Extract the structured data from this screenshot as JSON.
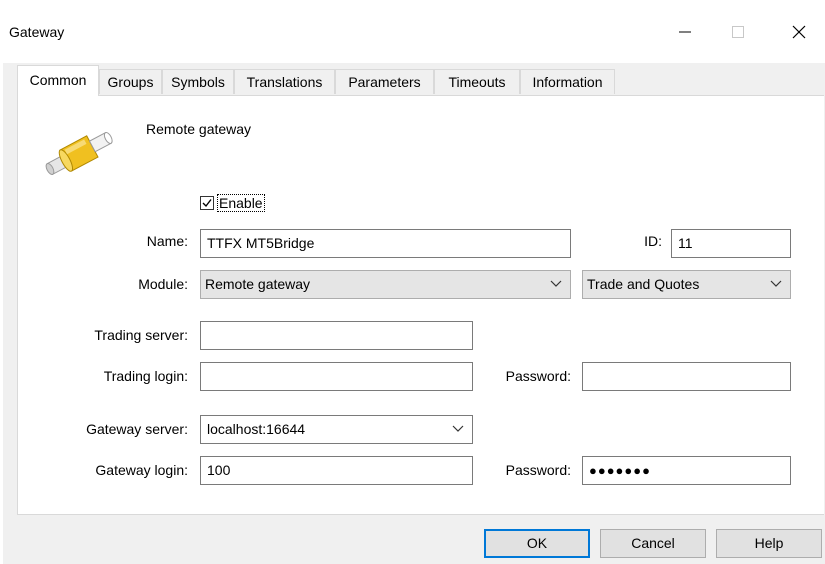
{
  "window": {
    "title": "Gateway"
  },
  "tabs": [
    {
      "label": "Common",
      "active": true
    },
    {
      "label": "Groups"
    },
    {
      "label": "Symbols"
    },
    {
      "label": "Translations"
    },
    {
      "label": "Parameters"
    },
    {
      "label": "Timeouts"
    },
    {
      "label": "Information"
    }
  ],
  "header": {
    "label": "Remote gateway",
    "icon": "gateway-connector-icon"
  },
  "enable": {
    "label": "Enable",
    "checked": true
  },
  "form": {
    "name_label": "Name:",
    "name_value": "TTFX MT5Bridge",
    "id_label": "ID:",
    "id_value": "11",
    "module_label": "Module:",
    "module_value": "Remote gateway",
    "mode_value": "Trade and Quotes",
    "trading_server_label": "Trading server:",
    "trading_server_value": "",
    "trading_login_label": "Trading login:",
    "trading_login_value": "",
    "trading_password_label": "Password:",
    "trading_password_value": "",
    "gateway_server_label": "Gateway server:",
    "gateway_server_value": "localhost:16644",
    "gateway_login_label": "Gateway login:",
    "gateway_login_value": "100",
    "gateway_password_label": "Password:",
    "gateway_password_value": "●●●●●●●"
  },
  "buttons": {
    "ok": "OK",
    "cancel": "Cancel",
    "help": "Help"
  },
  "colors": {
    "accent": "#0078d7",
    "panel": "#ffffff",
    "window": "#f0f0f0",
    "connector": "#f0c020"
  }
}
